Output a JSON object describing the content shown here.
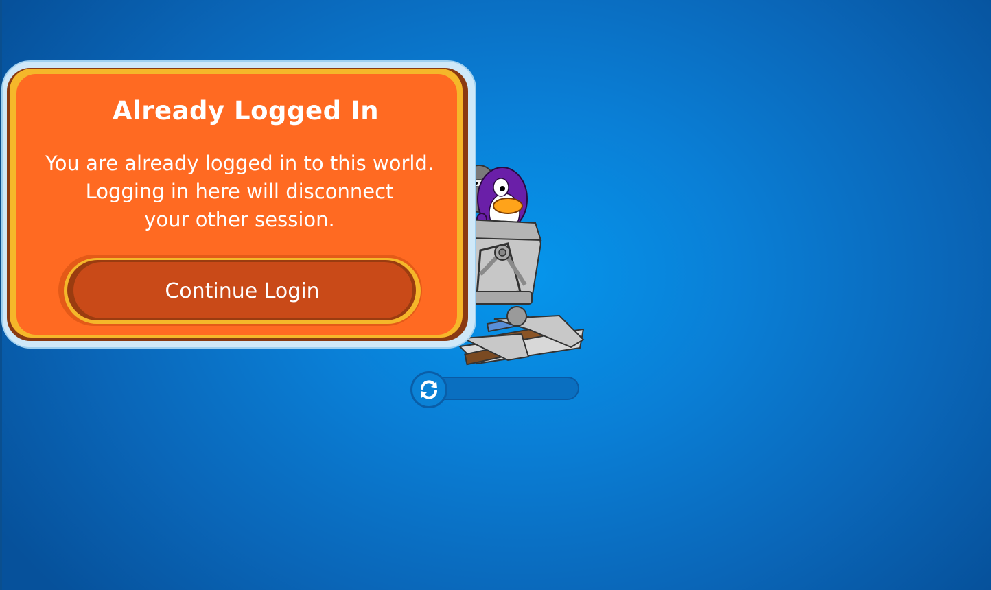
{
  "dialog": {
    "title": "Already Logged In",
    "message_lines": [
      "You are already logged in to this world.",
      "Logging in here will disconnect",
      "your other session."
    ],
    "continue_label": "Continue Login"
  },
  "loader": {
    "progress": 0,
    "icon": "refresh-icon"
  },
  "scene": {
    "icons": [
      "mine-cart-icon",
      "purple-penguin-icon",
      "gray-penguin-icon",
      "rail-track-icon"
    ]
  },
  "colors": {
    "background": "#0a7fd6",
    "dialog_orange": "#ff6a22",
    "dialog_gold": "#f5b72a",
    "button_orange": "#c94a18",
    "text": "#ffffff"
  }
}
